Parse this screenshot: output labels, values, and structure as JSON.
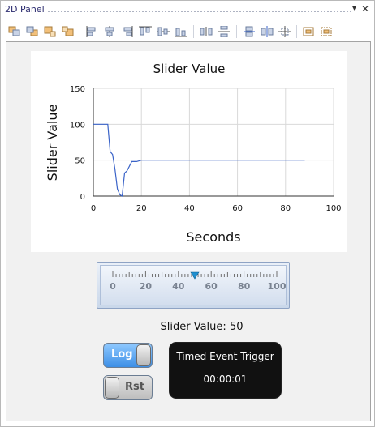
{
  "panel": {
    "title": "2D Panel",
    "pin_glyph": "▾",
    "close_glyph": "✕"
  },
  "toolbar": {
    "icons": [
      "bring-to-front-icon",
      "send-to-back-icon",
      "bring-forward-icon",
      "send-backward-icon",
      "align-left-icon",
      "align-center-icon",
      "align-right-icon",
      "align-top-icon",
      "align-middle-icon",
      "align-bottom-icon",
      "distribute-horizontal-icon",
      "distribute-vertical-icon",
      "same-width-icon",
      "same-height-icon",
      "same-size-icon",
      "group-icon",
      "ungroup-icon"
    ]
  },
  "chart_data": {
    "type": "line",
    "title": "Slider Value",
    "xlabel": "Seconds",
    "ylabel": "Slider Value",
    "xlim": [
      0,
      100
    ],
    "ylim": [
      0,
      150
    ],
    "xticks": [
      0,
      20,
      40,
      60,
      80,
      100
    ],
    "yticks": [
      0,
      50,
      100,
      150
    ],
    "grid": true,
    "line_color": "#3a63c8",
    "series": [
      {
        "x": [
          0,
          6,
          7,
          8,
          9,
          10,
          11,
          12,
          13,
          14,
          16,
          18,
          20,
          88
        ],
        "y": [
          100,
          100,
          62,
          58,
          38,
          10,
          2,
          0,
          32,
          35,
          48,
          48,
          50,
          50
        ]
      }
    ]
  },
  "slider": {
    "ticks": [
      "0",
      "20",
      "40",
      "60",
      "80",
      "100"
    ],
    "min": 0,
    "max": 100,
    "value": 50,
    "thumb_color": "#1f8fcf"
  },
  "value_label": {
    "prefix": "Slider Value:",
    "value": "50"
  },
  "buttons": {
    "log_label": "Log",
    "rst_label": "Rst",
    "log_on_color": "#3d8fe6"
  },
  "timer": {
    "title": "Timed Event Trigger",
    "time": "00:00:01"
  }
}
